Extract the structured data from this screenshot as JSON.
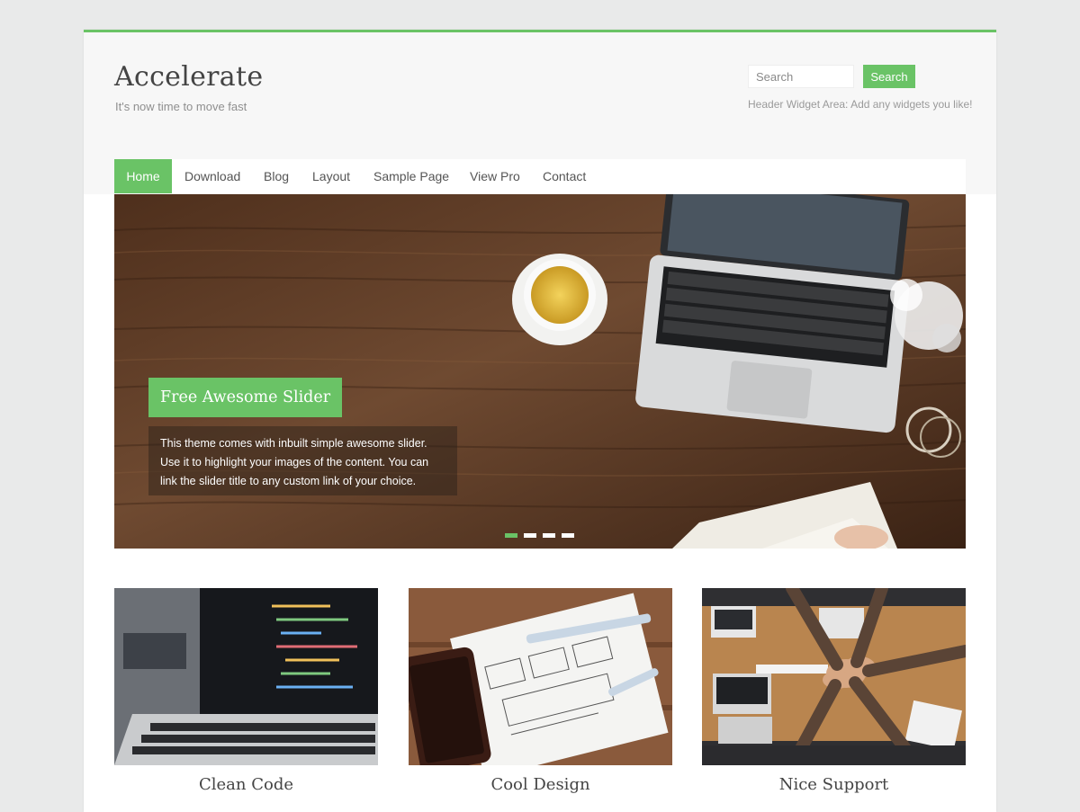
{
  "header": {
    "site_title": "Accelerate",
    "tagline": "It's now time to move fast",
    "search_placeholder": "Search",
    "search_button": "Search",
    "widget_text": "Header Widget Area: Add any widgets you like!"
  },
  "nav": {
    "items": [
      {
        "label": "Home",
        "active": true
      },
      {
        "label": "Download"
      },
      {
        "label": "Blog"
      },
      {
        "label": "Layout"
      },
      {
        "label": "Sample Page"
      },
      {
        "label": "View Pro"
      },
      {
        "label": "Contact"
      }
    ]
  },
  "slider": {
    "title": "Free Awesome Slider",
    "caption_lines": [
      "This theme comes with inbuilt simple awesome slider.",
      "Use it to highlight your images of the content. You can",
      "link the slider title to any custom link of your choice."
    ],
    "slide_count": 4,
    "active_slide": 1
  },
  "features": [
    {
      "title": "Clean Code"
    },
    {
      "title": "Cool Design"
    },
    {
      "title": "Nice Support"
    }
  ],
  "colors": {
    "accent": "#6ac366",
    "page_bg": "#e9eaea",
    "header_bg": "#f7f7f7",
    "text": "#444444"
  }
}
